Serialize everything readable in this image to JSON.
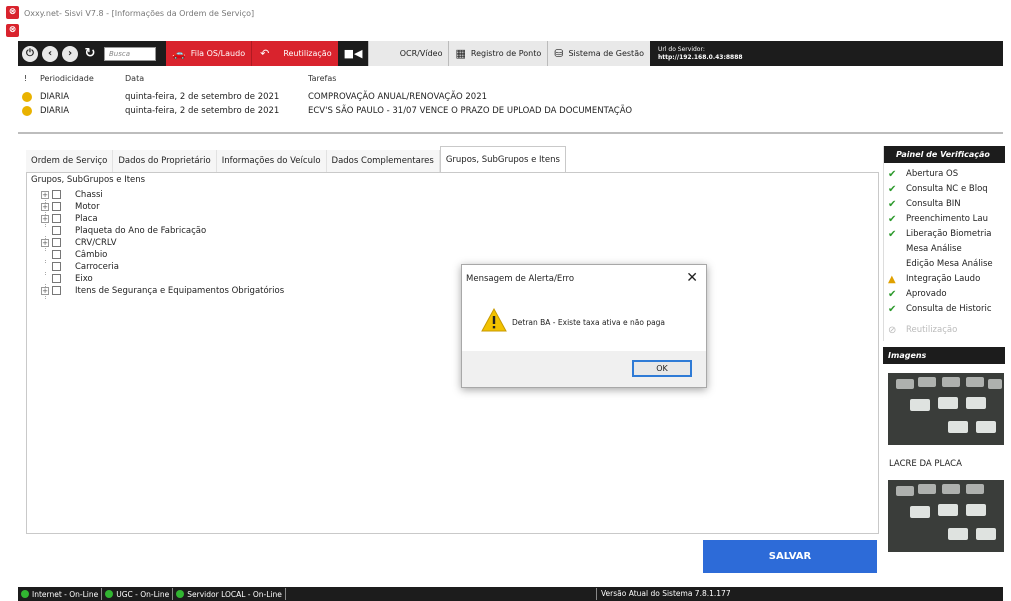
{
  "window": {
    "title": "Oxxy.net- Sisvi V7.8 - [Informações da Ordem de Serviço]"
  },
  "toolbar": {
    "search_placeholder": "Busca",
    "fila_label": "Fila OS/Laudo",
    "reutilizacao_label": "Reutilização",
    "ocr_label": "OCR/Vídeo",
    "registro_label": "Registro de Ponto",
    "sistema_label": "Sistema de Gestão",
    "server_label": "Url do Servidor:",
    "server_url": "http://192.168.0.43:8888"
  },
  "tasks": {
    "headers": {
      "num": "!",
      "periodicidade": "Periodicidade",
      "data": "Data",
      "tarefas": "Tarefas"
    },
    "rows": [
      {
        "periodicidade": "DIARIA",
        "data": "quinta-feira, 2 de setembro de 2021",
        "tarefa": "COMPROVAÇÃO ANUAL/RENOVAÇÃO 2021"
      },
      {
        "periodicidade": "DIARIA",
        "data": "quinta-feira, 2 de setembro de 2021",
        "tarefa": "ECV'S SÃO PAULO - 31/07 VENCE O PRAZO DE UPLOAD DA DOCUMENTAÇÃO"
      }
    ]
  },
  "tabs": [
    "Ordem de Serviço",
    "Dados do Proprietário",
    "Informações do Veículo",
    "Dados Complementares",
    "Grupos, SubGrupos e Itens"
  ],
  "tree": {
    "title": "Grupos, SubGrupos e Itens",
    "items": [
      {
        "label": "Chassi",
        "expandable": true
      },
      {
        "label": "Motor",
        "expandable": true
      },
      {
        "label": "Placa",
        "expandable": true
      },
      {
        "label": "Plaqueta do Ano de Fabricação",
        "expandable": false
      },
      {
        "label": "CRV/CRLV",
        "expandable": true
      },
      {
        "label": "Câmbio",
        "expandable": false
      },
      {
        "label": "Carroceria",
        "expandable": false
      },
      {
        "label": "Eixo",
        "expandable": false
      },
      {
        "label": "Itens de Segurança e Equipamentos Obrigatórios",
        "expandable": true
      }
    ]
  },
  "save_label": "SALVAR",
  "panel": {
    "title": "Painel de Verificação",
    "items": [
      {
        "label": "Abertura OS",
        "status": "ok"
      },
      {
        "label": "Consulta NC e Bloq",
        "status": "ok"
      },
      {
        "label": "Consulta BIN",
        "status": "ok"
      },
      {
        "label": "Preenchimento Lau",
        "status": "ok"
      },
      {
        "label": "Liberação Biometria",
        "status": "ok"
      },
      {
        "label": "Mesa Análise",
        "status": "none"
      },
      {
        "label": "Edição Mesa Análise",
        "status": "none"
      },
      {
        "label": "Integração Laudo",
        "status": "warn"
      },
      {
        "label": "Aprovado",
        "status": "ok"
      },
      {
        "label": "Consulta de Historic",
        "status": "ok"
      },
      {
        "label": "Reutilização",
        "status": "disabled"
      }
    ]
  },
  "images": {
    "title": "Imagens",
    "items": [
      {
        "caption": "LACRE DA PLACA"
      }
    ]
  },
  "statusbar": {
    "internet": "Internet - On-Line",
    "ugc": "UGC - On-Line",
    "servidor": "Servidor LOCAL - On-Line",
    "version": "Versão Atual do Sistema 7.8.1.177"
  },
  "dialog": {
    "title": "Mensagem de Alerta/Erro",
    "message": "Detran BA - Existe taxa ativa e não paga",
    "ok_label": "OK"
  },
  "colors": {
    "accent_red": "#d9232d",
    "save_blue": "#2d6bd8",
    "dark_bar": "#1c1c1c",
    "ok_green": "#2d9a2d",
    "warn_yellow": "#e0a000"
  }
}
